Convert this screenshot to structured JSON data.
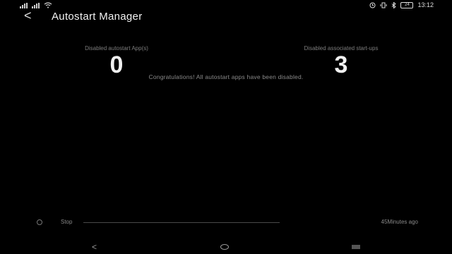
{
  "status_bar": {
    "time": "13:12",
    "battery": "24",
    "icons": [
      "signal-icon",
      "signal-icon",
      "wifi-icon",
      "alarm-icon",
      "vibrate-icon",
      "bluetooth-icon",
      "battery-icon"
    ]
  },
  "app_bar": {
    "back_glyph": "<",
    "title": "Autostart Manager"
  },
  "stats": {
    "disabled_apps_label": "Disabled autostart App(s)",
    "disabled_apps_value": "0",
    "associated_label": "Disabled associated start-ups",
    "associated_value": "3"
  },
  "message": "Congratulations! All autostart apps have been disabled.",
  "bottom": {
    "stop_label": "Stop",
    "time_label": "45Minutes ago"
  },
  "nav": {
    "back_glyph": "<"
  }
}
